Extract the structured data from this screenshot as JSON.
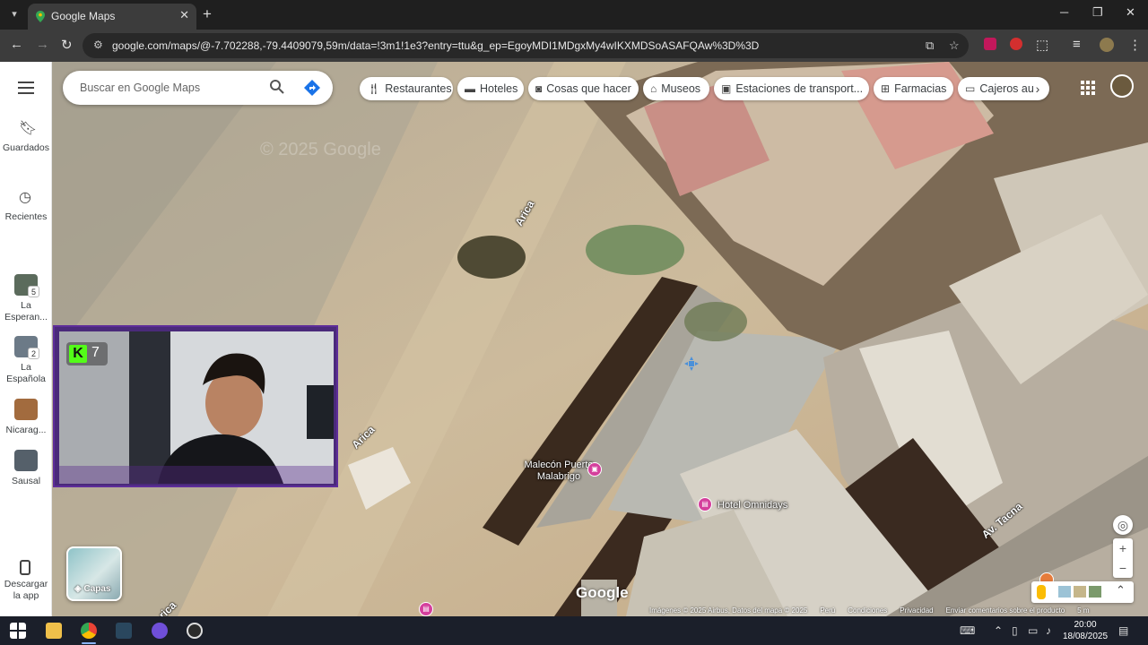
{
  "browser": {
    "tab_title": "Google Maps",
    "url_main": "google.com/maps/@-7.702288,-79.4409079,59m/data=!3m1!1e3?entry=ttu&g_ep=EgoyMDI1MDgxMy4wIKXMDSoASAFQAw%3D%3D",
    "new_tab_label": "+",
    "close_label": "✕",
    "minimize_label": "─",
    "restore_label": "❐",
    "win_close_label": "✕"
  },
  "rail": {
    "saved_label": "Guardados",
    "recent_label": "Recientes",
    "places": [
      {
        "label": "La Esperan...",
        "badge": "5"
      },
      {
        "label": "La Española",
        "badge": "2"
      },
      {
        "label": "Nicarag...",
        "badge": ""
      },
      {
        "label": "Sausal",
        "badge": ""
      }
    ],
    "download_label": "Descargar la app"
  },
  "search": {
    "placeholder": "Buscar en Google Maps"
  },
  "chips": [
    {
      "icon": "fork-knife-icon",
      "label": "Restaurantes"
    },
    {
      "icon": "bed-icon",
      "label": "Hoteles"
    },
    {
      "icon": "camera-icon",
      "label": "Cosas que hacer"
    },
    {
      "icon": "museum-icon",
      "label": "Museos"
    },
    {
      "icon": "bus-icon",
      "label": "Estaciones de transport..."
    },
    {
      "icon": "pharmacy-icon",
      "label": "Farmacias"
    },
    {
      "icon": "atm-icon",
      "label": "Cajeros au"
    }
  ],
  "webcam": {
    "badge_letter": "K",
    "badge_count": "7"
  },
  "map": {
    "streets": [
      "Arica",
      "Arica",
      "Av. Tacna",
      "rica"
    ],
    "pois": [
      {
        "name": "Malecón Puerto Malabrigo"
      },
      {
        "name": "Hotel Omnidays"
      }
    ],
    "google_logo": "Google",
    "watermark": "© 2025 Google",
    "layers_label": "Capas",
    "scale": "5 m"
  },
  "attribution": {
    "imagery": "Imágenes © 2025 Airbus, Datos del mapa © 2025",
    "country": "Perú",
    "terms": "Condiciones",
    "privacy": "Privacidad",
    "feedback": "Enviar comentarios sobre el producto"
  },
  "taskbar": {
    "time": "20:00",
    "date": "18/08/2025"
  },
  "colors": {
    "chip_bg": "#ffffff",
    "poi_pink": "#d43f9c",
    "kick_green": "#53fc18",
    "cam_frame": "#5e2d9a"
  }
}
